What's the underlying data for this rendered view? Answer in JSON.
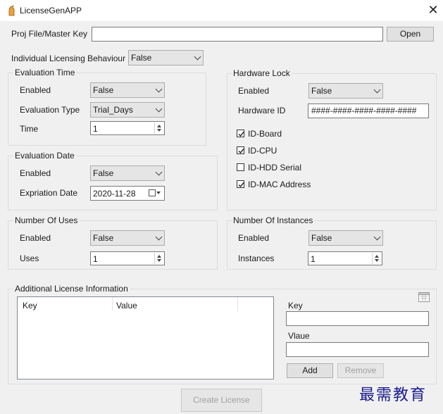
{
  "window": {
    "title": "LicenseGenAPP"
  },
  "proj_file": {
    "label": "Proj File/Master Key",
    "value": "",
    "open_button": "Open"
  },
  "individual_licensing": {
    "label": "Individual Licensing Behaviour",
    "value": "False"
  },
  "evaluation_time": {
    "legend": "Evaluation Time",
    "enabled_label": "Enabled",
    "enabled_value": "False",
    "type_label": "Evaluation Type",
    "type_value": "Trial_Days",
    "time_label": "Time",
    "time_value": "1"
  },
  "evaluation_date": {
    "legend": "Evaluation Date",
    "enabled_label": "Enabled",
    "enabled_value": "False",
    "expiration_label": "Expriation Date",
    "expiration_value": "2020-11-28"
  },
  "number_of_uses": {
    "legend": "Number Of Uses",
    "enabled_label": "Enabled",
    "enabled_value": "False",
    "uses_label": "Uses",
    "uses_value": "1"
  },
  "hardware_lock": {
    "legend": "Hardware Lock",
    "enabled_label": "Enabled",
    "enabled_value": "False",
    "hardware_id_label": "Hardware ID",
    "hardware_id_value": "####-####-####-####-####",
    "checkboxes": [
      {
        "label": "ID-Board",
        "checked": true
      },
      {
        "label": "ID-CPU",
        "checked": true
      },
      {
        "label": "ID-HDD Serial",
        "checked": false
      },
      {
        "label": "ID-MAC Address",
        "checked": true
      }
    ]
  },
  "number_of_instances": {
    "legend": "Number Of Instances",
    "enabled_label": "Enabled",
    "enabled_value": "False",
    "instances_label": "Instances",
    "instances_value": "1"
  },
  "additional_info": {
    "legend": "Additional License Information",
    "columns": [
      "Key",
      "Value"
    ],
    "key_label": "Key",
    "key_value": "",
    "value_label": "Vlaue",
    "value_value": "",
    "add_button": "Add",
    "remove_button": "Remove"
  },
  "create_license_button": "Create License",
  "watermark": "最需教育"
}
